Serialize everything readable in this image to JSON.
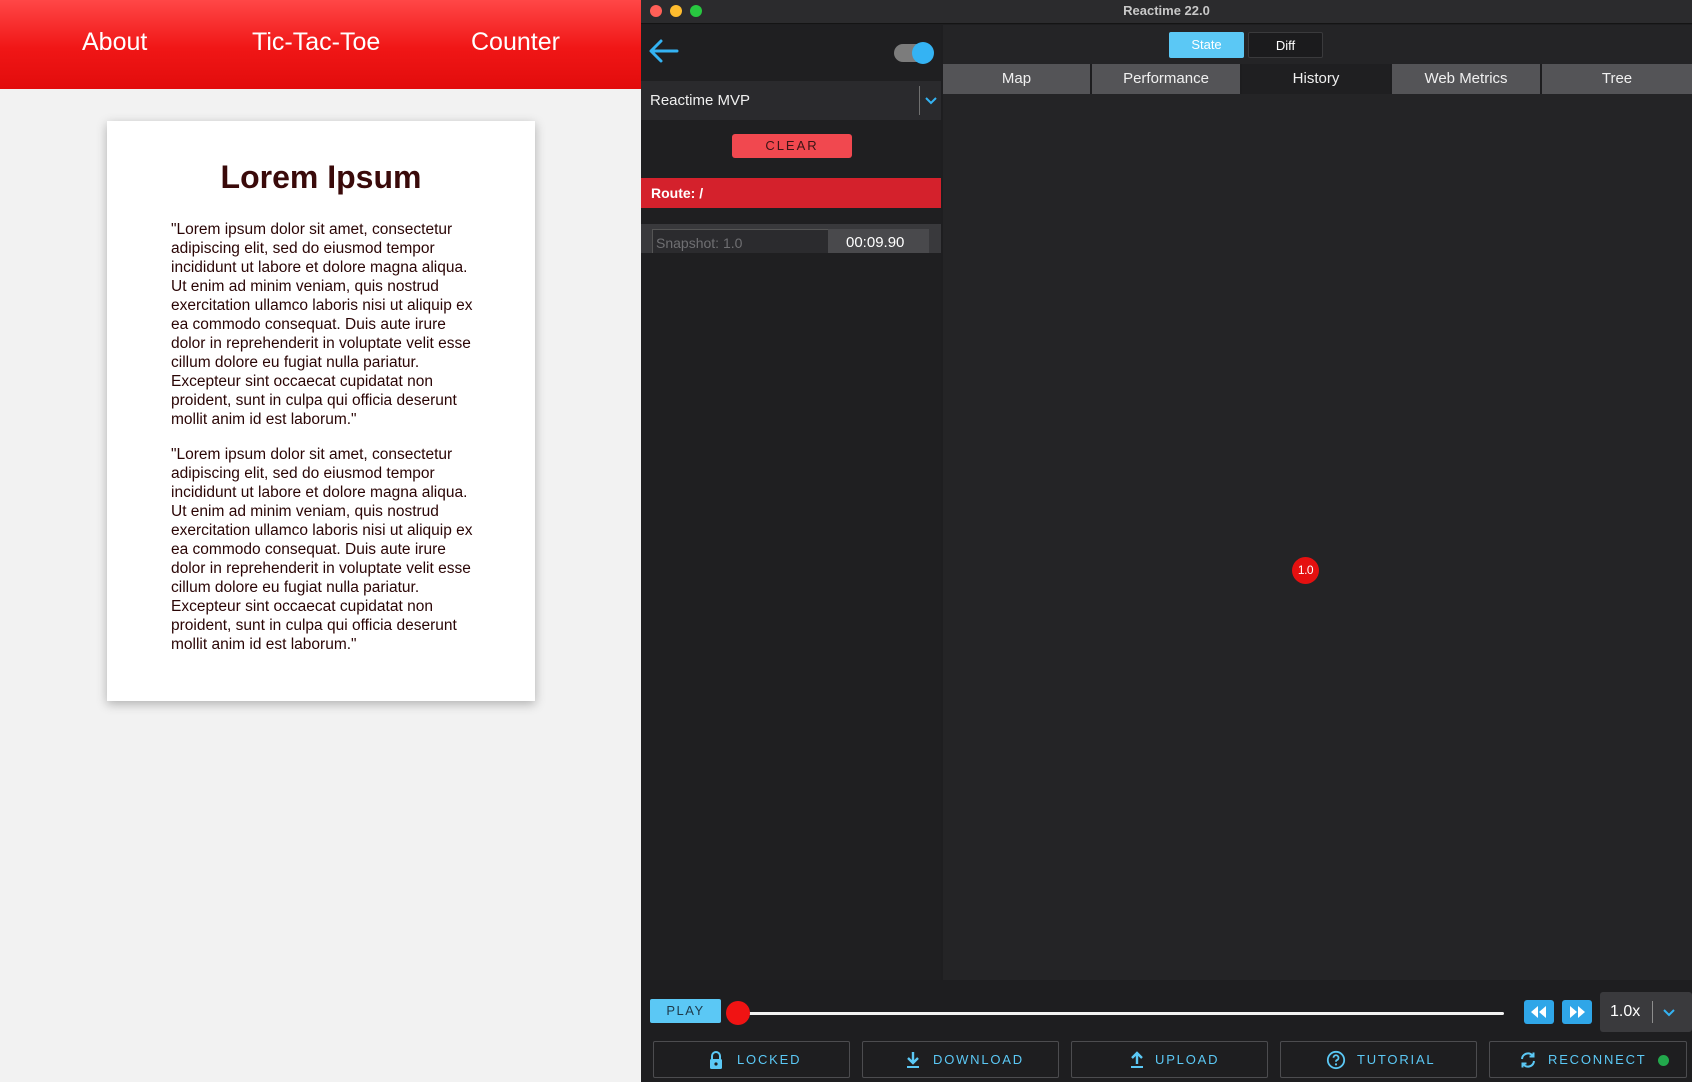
{
  "left_app": {
    "nav": {
      "about": "About",
      "tic_tac_toe": "Tic-Tac-Toe",
      "counter": "Counter"
    },
    "card": {
      "title": "Lorem Ipsum",
      "paragraphs": [
        "\"Lorem ipsum dolor sit amet, consectetur adipiscing elit, sed do eiusmod tempor incididunt ut labore et dolore magna aliqua. Ut enim ad minim veniam, quis nostrud exercitation ullamco laboris nisi ut aliquip ex ea commodo consequat. Duis aute irure dolor in reprehenderit in voluptate velit esse cillum dolore eu fugiat nulla pariatur. Excepteur sint occaecat cupidatat non proident, sunt in culpa qui officia deserunt mollit anim id est laborum.\"",
        "\"Lorem ipsum dolor sit amet, consectetur adipiscing elit, sed do eiusmod tempor incididunt ut labore et dolore magna aliqua. Ut enim ad minim veniam, quis nostrud exercitation ullamco laboris nisi ut aliquip ex ea commodo consequat. Duis aute irure dolor in reprehenderit in voluptate velit esse cillum dolore eu fugiat nulla pariatur. Excepteur sint occaecat cupidatat non proident, sunt in culpa qui officia deserunt mollit anim id est laborum.\""
      ]
    },
    "colors": {
      "nav_red": "#f01616",
      "title_text": "#3a0a0a"
    }
  },
  "devtools": {
    "window_title": "Reactime 22.0",
    "sidebar": {
      "back_icon": "arrow-left-icon",
      "toggle_on": true,
      "app_select": "Reactime MVP",
      "clear_label": "CLEAR",
      "route_label": "Route: /",
      "snapshot": {
        "label": "Snapshot: 1.0",
        "time": "00:09.90"
      }
    },
    "view_modes": {
      "state": "State",
      "diff": "Diff",
      "active": "State"
    },
    "tabs": [
      "Map",
      "Performance",
      "History",
      "Web Metrics",
      "Tree"
    ],
    "active_tab": "History",
    "history_nodes": [
      "1.0"
    ],
    "timeline": {
      "play_label": "PLAY",
      "slider_position": 0,
      "speed": "1.0x"
    },
    "actions": {
      "locked": {
        "label": "LOCKED",
        "icon": "lock-icon"
      },
      "download": {
        "label": "DOWNLOAD",
        "icon": "download-icon"
      },
      "upload": {
        "label": "UPLOAD",
        "icon": "upload-icon"
      },
      "tutorial": {
        "label": "TUTORIAL",
        "icon": "help-circle-icon"
      },
      "reconnect": {
        "label": "RECONNECT",
        "icon": "sync-icon",
        "status": "connected"
      }
    },
    "colors": {
      "accent_blue": "#5bc8f5",
      "route_red": "#d4212c",
      "clear_red": "#f1484f",
      "node_red": "#e51010",
      "status_green": "#22a84c"
    }
  }
}
